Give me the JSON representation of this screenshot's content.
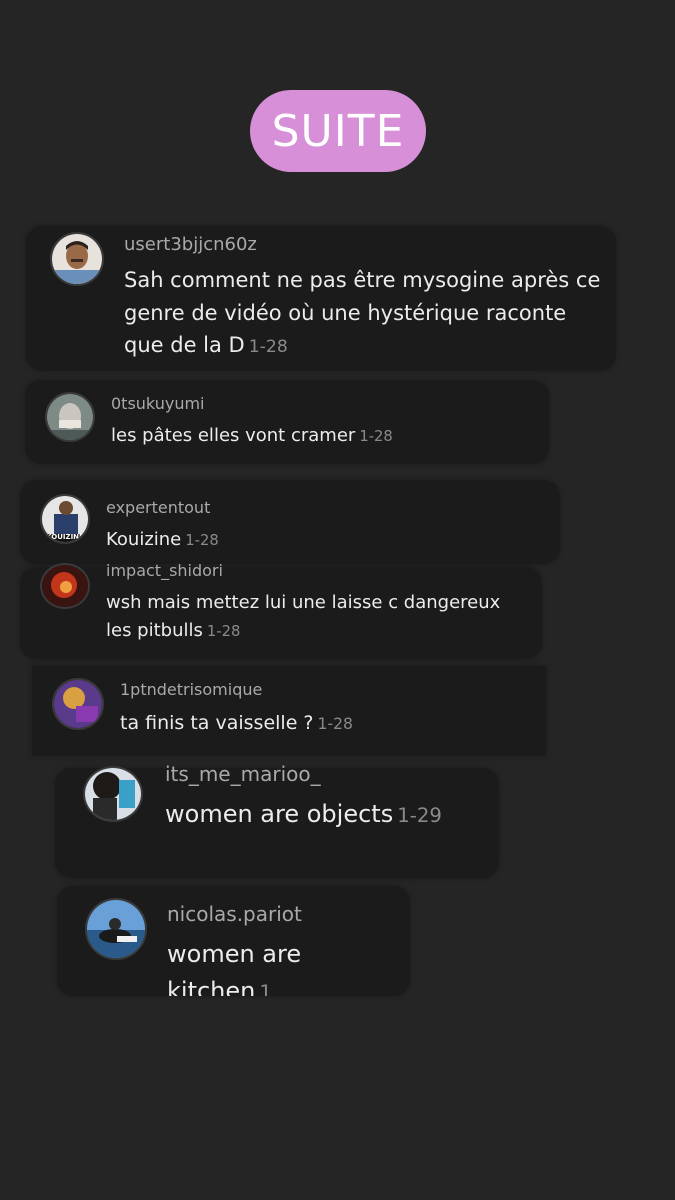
{
  "header": {
    "button_label": "SUITE"
  },
  "comments": [
    {
      "username": "usert3bjjcn60z",
      "lines": [
        "Sah comment ne pas être mysogine après ce",
        "genre de vidéo où une hystérique raconte",
        "que de la D"
      ],
      "timestamp": "1-28"
    },
    {
      "username": "0tsukuyumi",
      "lines": [
        "les pâtes elles vont cramer"
      ],
      "timestamp": "1-28"
    },
    {
      "username": "expertentout",
      "lines": [
        "Kouizine"
      ],
      "timestamp": "1-28",
      "avatar_caption": "KOUIZINE"
    },
    {
      "username": "impact_shidori",
      "lines": [
        "wsh mais mettez lui une laisse c dangereux",
        "les pitbulls"
      ],
      "timestamp": "1-28"
    },
    {
      "username": "1ptndetrisomique",
      "lines": [
        "ta finis ta vaisselle ?"
      ],
      "timestamp": "1-28"
    },
    {
      "username": "its_me_marioo_",
      "lines": [
        "women are objects"
      ],
      "timestamp": "1-29"
    },
    {
      "username": "nicolas.pariot",
      "lines": [
        "women are kitchen"
      ],
      "timestamp": "1"
    }
  ],
  "colors": {
    "background": "#252525",
    "card": "#1b1b1b",
    "accent": "#d790d8"
  }
}
